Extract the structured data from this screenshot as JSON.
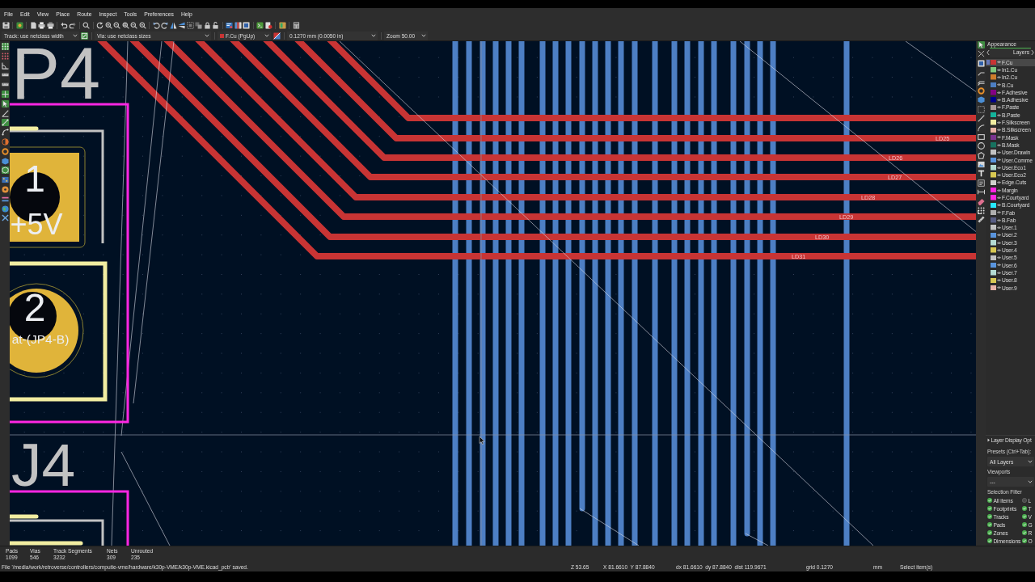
{
  "menu_bar": [
    "File",
    "Edit",
    "View",
    "Place",
    "Route",
    "Inspect",
    "Tools",
    "Preferences",
    "Help"
  ],
  "aux_toolbar": {
    "track_width": "Track: use netclass width",
    "auto_width": {
      "on": true
    },
    "via_size": "Via: use netclass sizes",
    "active_layer": "F.Cu (PgUp)",
    "grid": "0.1270 mm (0.0050 in)",
    "zoom": "Zoom 50.00"
  },
  "left_toolbar": [
    {
      "kind": "grid",
      "on": true
    },
    {
      "kind": "grid-override",
      "on": false
    },
    {
      "kind": "polar",
      "on": false
    },
    {
      "kind": "ruler",
      "on": false
    },
    {
      "kind": "ruler",
      "on": false
    },
    {
      "kind": "crosshair",
      "on": true
    },
    {
      "kind": "cursor",
      "on": true
    },
    {
      "kind": "angle",
      "on": false
    },
    {
      "kind": "ratsnest",
      "on": true
    },
    {
      "kind": "ratsnest-curved",
      "on": false
    },
    {
      "kind": "contrast",
      "on": false
    },
    {
      "kind": "via",
      "on": false
    },
    {
      "kind": "zone-filled",
      "on": false
    },
    {
      "kind": "zone-outline",
      "on": true
    },
    {
      "kind": "board",
      "on": false
    },
    {
      "kind": "pad",
      "on": false
    },
    {
      "kind": "net-colors",
      "on": false
    },
    {
      "kind": "globe",
      "on": false
    },
    {
      "kind": "tools",
      "on": false
    }
  ],
  "canvas": {
    "references": [
      "P4",
      "J4"
    ],
    "pads": [
      {
        "kind": "square",
        "number": "1",
        "net": "+5V"
      },
      {
        "kind": "round",
        "number": "2",
        "net": "at-(JP4-B)"
      }
    ],
    "track_labels": [
      "LD25",
      "LD26",
      "LD27",
      "LD28",
      "LD29",
      "LD30",
      "LD31"
    ]
  },
  "right_toolbar": [
    {
      "kind": "select",
      "selected": true
    },
    {
      "kind": "cross",
      "selected": false
    },
    {
      "kind": "footprint",
      "selected": false
    },
    {
      "kind": "track",
      "selected": false
    },
    {
      "kind": "diff-pair",
      "selected": false
    },
    {
      "kind": "via",
      "selected": false
    },
    {
      "kind": "zone",
      "selected": false
    },
    {
      "kind": "rule-area",
      "selected": false
    },
    {
      "kind": "line",
      "selected": false
    },
    {
      "kind": "arc",
      "selected": false
    },
    {
      "kind": "rectangle",
      "selected": false
    },
    {
      "kind": "circle",
      "selected": false
    },
    {
      "kind": "polygon",
      "selected": false
    },
    {
      "kind": "image",
      "selected": false
    },
    {
      "kind": "text",
      "selected": false
    },
    {
      "kind": "textbox",
      "selected": false
    },
    {
      "kind": "dimension",
      "selected": false
    },
    {
      "kind": "eraser",
      "selected": false
    },
    {
      "kind": "grid-origin",
      "selected": false
    },
    {
      "kind": "measure",
      "selected": false
    }
  ],
  "appearance": {
    "title": "Appearance",
    "tabs": [
      {
        "label": "Layers",
        "selected": true
      }
    ],
    "layers": [
      {
        "name": "F.Cu",
        "color": "#c83434",
        "selected": true
      },
      {
        "name": "In1.Cu",
        "color": "#7fc87f",
        "selected": false
      },
      {
        "name": "In2.Cu",
        "color": "#ce7d2c",
        "selected": false
      },
      {
        "name": "B.Cu",
        "color": "#4d7fc4",
        "selected": false
      },
      {
        "name": "F.Adhesive",
        "color": "#840084",
        "selected": false
      },
      {
        "name": "B.Adhesive",
        "color": "#00008a",
        "selected": false
      },
      {
        "name": "F.Paste",
        "color": "#a99a99",
        "selected": false
      },
      {
        "name": "B.Paste",
        "color": "#14b49b",
        "selected": false
      },
      {
        "name": "F.Silkscreen",
        "color": "#f2eda1",
        "selected": false
      },
      {
        "name": "B.Silkscreen",
        "color": "#e8b2a7",
        "selected": false
      },
      {
        "name": "F.Mask",
        "color": "#7b3490",
        "selected": false
      },
      {
        "name": "B.Mask",
        "color": "#17735f",
        "selected": false
      },
      {
        "name": "User.Drawin",
        "color": "#c2c2c2",
        "selected": false
      },
      {
        "name": "User.Comme",
        "color": "#5994dc",
        "selected": false
      },
      {
        "name": "User.Eco1",
        "color": "#b4dbd2",
        "selected": false
      },
      {
        "name": "User.Eco2",
        "color": "#d8c852",
        "selected": false
      },
      {
        "name": "Edge.Cuts",
        "color": "#d0d2cd",
        "selected": false
      },
      {
        "name": "Margin",
        "color": "#ff26e2",
        "selected": false
      },
      {
        "name": "F.Courtyard",
        "color": "#ff26e3",
        "selected": false
      },
      {
        "name": "B.Courtyard",
        "color": "#26e9ff",
        "selected": false
      },
      {
        "name": "F.Fab",
        "color": "#afafaf",
        "selected": false
      },
      {
        "name": "B.Fab",
        "color": "#585d84",
        "selected": false
      },
      {
        "name": "User.1",
        "color": "#c2c2c3",
        "selected": false
      },
      {
        "name": "User.2",
        "color": "#5994dd",
        "selected": false
      },
      {
        "name": "User.3",
        "color": "#b4dbd3",
        "selected": false
      },
      {
        "name": "User.4",
        "color": "#d8c853",
        "selected": false
      },
      {
        "name": "User.5",
        "color": "#c2c2c4",
        "selected": false
      },
      {
        "name": "User.6",
        "color": "#5994de",
        "selected": false
      },
      {
        "name": "User.7",
        "color": "#b4dbd4",
        "selected": false
      },
      {
        "name": "User.8",
        "color": "#d8c854",
        "selected": false
      },
      {
        "name": "User.9",
        "color": "#e8b2a8",
        "selected": false
      }
    ],
    "layer_display_options": {
      "label": "Layer Display Opt",
      "expanded": false
    },
    "presets_label": "Presets (Ctrl+Tab):",
    "preset": "All Layers",
    "viewports_label": "Viewports",
    "viewport": "---",
    "selection_filter": {
      "title": "Selection Filter",
      "items": [
        {
          "label": "All items",
          "checked": true
        },
        {
          "label": "L",
          "checked": false
        },
        {
          "label": "Footprints",
          "checked": true
        },
        {
          "label": "T",
          "checked": true
        },
        {
          "label": "Tracks",
          "checked": true
        },
        {
          "label": "V",
          "checked": true
        },
        {
          "label": "Pads",
          "checked": true
        },
        {
          "label": "G",
          "checked": true
        },
        {
          "label": "Zones",
          "checked": true
        },
        {
          "label": "R",
          "checked": true
        },
        {
          "label": "Dimensions",
          "checked": true
        },
        {
          "label": "O",
          "checked": true
        }
      ]
    }
  },
  "message_panel": [
    {
      "label": "Pads",
      "value": "1099"
    },
    {
      "label": "Vias",
      "value": "546"
    },
    {
      "label": "Track Segments",
      "value": "3232"
    },
    {
      "label": "Nets",
      "value": "309"
    },
    {
      "label": "Unrouted",
      "value": "235"
    }
  ],
  "status_bar": {
    "message": "File '/media/work/retroverse/controllers/computie-vme/hardware/k30p-VME/k30p-VME.kicad_pcb' saved.",
    "zoom": "Z 53.65",
    "cursor": "X 81.6610  Y 87.8840",
    "delta": "dx 81.6610  dy 87.8840  dist 119.9671",
    "grid": "grid 0.1270",
    "units": "mm",
    "tool": "Select item(s)"
  }
}
